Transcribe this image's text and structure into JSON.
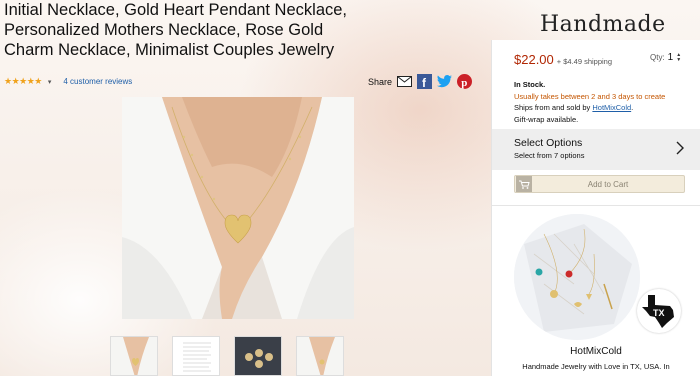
{
  "product": {
    "title": "Initial Necklace, Gold Heart Pendant Necklace, Personalized Mothers Necklace, Rose Gold Charm Necklace, Minimalist Couples Jewelry",
    "rating_stars": "★★★★★",
    "rating_value": 4.5,
    "rating_caret": "▾",
    "reviews_link": "4 customer reviews"
  },
  "share": {
    "label": "Share",
    "icons": [
      "email-icon",
      "facebook-icon",
      "twitter-icon",
      "pinterest-icon"
    ]
  },
  "gallery": {
    "thumbnails": [
      "thumbnail-1",
      "thumbnail-2",
      "thumbnail-3",
      "thumbnail-4"
    ]
  },
  "buybox": {
    "brand_logo": "Handmade",
    "price": "$22.00",
    "shipping": "+ $4.49 shipping",
    "qty_label": "Qty:",
    "qty_value": "1",
    "in_stock": "In Stock.",
    "delivery": "Usually takes between 2 and 3 days to create",
    "ships_from_prefix": "Ships from and sold by",
    "seller": "HotMixCold",
    "ships_from_suffix": ".",
    "gift_wrap": "Gift-wrap available.",
    "select_options_title": "Select Options",
    "select_options_sub": "Select from 7 options",
    "add_to_cart": "Add to Cart"
  },
  "shop": {
    "badge_text": "TX",
    "name": "HotMixCold",
    "tagline": "Handmade Jewelry with Love in TX, USA. In"
  },
  "colors": {
    "price": "#b12704",
    "link": "#1f5fa8",
    "delivery": "#c45500",
    "stars": "#f0a21b",
    "facebook": "#3b5998",
    "twitter": "#1da1f2",
    "pinterest": "#cb2027"
  }
}
